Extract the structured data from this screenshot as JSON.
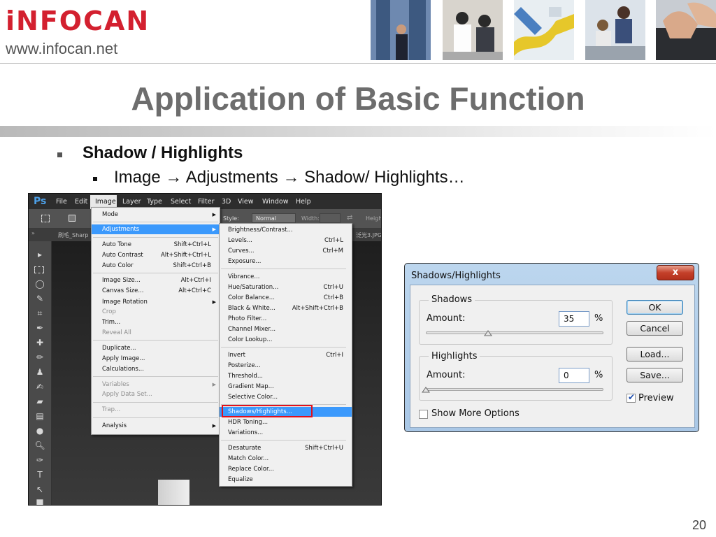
{
  "header": {
    "brand": "iNFOCAN",
    "url": "www.infocan.net"
  },
  "slide": {
    "title": "Application of Basic Function",
    "bullet1": "Shadow / Highlights",
    "bullet2": "Image → Adjustments → Shadow/ Highlights…",
    "page_number": "20"
  },
  "photoshop": {
    "logo": "Ps",
    "menubar": [
      "File",
      "Edit",
      "Image",
      "Layer",
      "Type",
      "Select",
      "Filter",
      "3D",
      "View",
      "Window",
      "Help"
    ],
    "options": {
      "style_label": "Style:",
      "style_value": "Normal",
      "width_label": "Width:",
      "height_label": "Heigh"
    },
    "tabs": {
      "left": "刷毛_Sharp",
      "right": "泛光3.JPG"
    },
    "image_menu": [
      {
        "label": "Mode",
        "shortcut": "",
        "submenu": true
      },
      {
        "label": "Adjustments",
        "shortcut": "",
        "submenu": true,
        "highlight": true
      },
      {
        "label": "Auto Tone",
        "shortcut": "Shift+Ctrl+L"
      },
      {
        "label": "Auto Contrast",
        "shortcut": "Alt+Shift+Ctrl+L"
      },
      {
        "label": "Auto Color",
        "shortcut": "Shift+Ctrl+B"
      },
      {
        "label": "Image Size...",
        "shortcut": "Alt+Ctrl+I"
      },
      {
        "label": "Canvas Size...",
        "shortcut": "Alt+Ctrl+C"
      },
      {
        "label": "Image Rotation",
        "shortcut": "",
        "submenu": true
      },
      {
        "label": "Crop",
        "shortcut": "",
        "disabled": true
      },
      {
        "label": "Trim...",
        "shortcut": ""
      },
      {
        "label": "Reveal All",
        "shortcut": "",
        "disabled": true
      },
      {
        "label": "Duplicate...",
        "shortcut": ""
      },
      {
        "label": "Apply Image...",
        "shortcut": ""
      },
      {
        "label": "Calculations...",
        "shortcut": ""
      },
      {
        "label": "Variables",
        "shortcut": "",
        "submenu": true,
        "disabled": true
      },
      {
        "label": "Apply Data Set...",
        "shortcut": "",
        "disabled": true
      },
      {
        "label": "Trap...",
        "shortcut": "",
        "disabled": true
      },
      {
        "label": "Analysis",
        "shortcut": "",
        "submenu": true
      }
    ],
    "adjust_menu": [
      {
        "label": "Brightness/Contrast...",
        "shortcut": ""
      },
      {
        "label": "Levels...",
        "shortcut": "Ctrl+L"
      },
      {
        "label": "Curves...",
        "shortcut": "Ctrl+M"
      },
      {
        "label": "Exposure...",
        "shortcut": ""
      },
      {
        "label": "Vibrance...",
        "shortcut": ""
      },
      {
        "label": "Hue/Saturation...",
        "shortcut": "Ctrl+U"
      },
      {
        "label": "Color Balance...",
        "shortcut": "Ctrl+B"
      },
      {
        "label": "Black & White...",
        "shortcut": "Alt+Shift+Ctrl+B"
      },
      {
        "label": "Photo Filter...",
        "shortcut": ""
      },
      {
        "label": "Channel Mixer...",
        "shortcut": ""
      },
      {
        "label": "Color Lookup...",
        "shortcut": ""
      },
      {
        "label": "Invert",
        "shortcut": "Ctrl+I"
      },
      {
        "label": "Posterize...",
        "shortcut": ""
      },
      {
        "label": "Threshold...",
        "shortcut": ""
      },
      {
        "label": "Gradient Map...",
        "shortcut": ""
      },
      {
        "label": "Selective Color...",
        "shortcut": ""
      },
      {
        "label": "Shadows/Highlights...",
        "shortcut": "",
        "highlight": true
      },
      {
        "label": "HDR Toning...",
        "shortcut": ""
      },
      {
        "label": "Variations...",
        "shortcut": ""
      },
      {
        "label": "Desaturate",
        "shortcut": "Shift+Ctrl+U"
      },
      {
        "label": "Match Color...",
        "shortcut": ""
      },
      {
        "label": "Replace Color...",
        "shortcut": ""
      },
      {
        "label": "Equalize",
        "shortcut": ""
      }
    ]
  },
  "dialog": {
    "title": "Shadows/Highlights",
    "close": "x",
    "shadows": {
      "group": "Shadows",
      "amount_label": "Amount:",
      "amount": "35",
      "unit": "%",
      "slider_fraction": 0.35
    },
    "highlights": {
      "group": "Highlights",
      "amount_label": "Amount:",
      "amount": "0",
      "unit": "%",
      "slider_fraction": 0.0
    },
    "buttons": {
      "ok": "OK",
      "cancel": "Cancel",
      "load": "Load...",
      "save": "Save..."
    },
    "preview": {
      "label": "Preview",
      "checked": true
    },
    "show_more": {
      "label": "Show More Options",
      "checked": false
    }
  }
}
